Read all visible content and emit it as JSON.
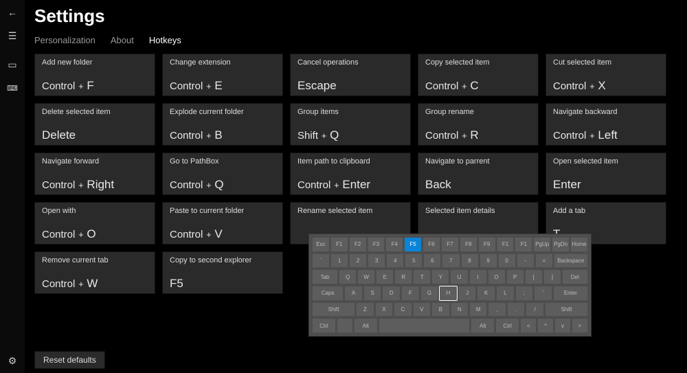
{
  "window": {
    "title": "Settings"
  },
  "tabs": [
    {
      "label": "Personalization",
      "active": false
    },
    {
      "label": "About",
      "active": false
    },
    {
      "label": "Hotkeys",
      "active": true
    }
  ],
  "hotkeys": [
    {
      "label": "Add new folder",
      "combo": "Control + F"
    },
    {
      "label": "Change extension",
      "combo": "Control + E"
    },
    {
      "label": "Cancel operations",
      "combo": "Escape"
    },
    {
      "label": "Copy selected item",
      "combo": "Control + C"
    },
    {
      "label": "Cut selected item",
      "combo": "Control + X"
    },
    {
      "label": "Delete selected item",
      "combo": "Delete"
    },
    {
      "label": "Explode current folder",
      "combo": "Control + B"
    },
    {
      "label": "Group items",
      "combo": "Shift + Q"
    },
    {
      "label": "Group rename",
      "combo": "Control + R"
    },
    {
      "label": "Navigate backward",
      "combo": "Control + Left"
    },
    {
      "label": "Navigate forward",
      "combo": "Control + Right"
    },
    {
      "label": "Go to PathBox",
      "combo": "Control + Q"
    },
    {
      "label": "Item path to clipboard",
      "combo": "Control + Enter"
    },
    {
      "label": "Navigate to parrent",
      "combo": "Back"
    },
    {
      "label": "Open selected item",
      "combo": "Enter"
    },
    {
      "label": "Open with",
      "combo": "Control + O"
    },
    {
      "label": "Paste to current folder",
      "combo": "Control + V"
    },
    {
      "label": "Rename selected item",
      "combo": ""
    },
    {
      "label": "Selected item details",
      "combo": ""
    },
    {
      "label": "Add a tab",
      "combo": "+ T"
    },
    {
      "label": "Remove current tab",
      "combo": "Control + W"
    },
    {
      "label": "Copy to second explorer",
      "combo": "F5"
    }
  ],
  "reset_label": "Reset defaults",
  "keyboard": {
    "highlighted": "F5",
    "selected": "H",
    "rows": [
      [
        "Esc",
        "F1",
        "F2",
        "F3",
        "F4",
        "F5",
        "F6",
        "F7",
        "F8",
        "F9",
        "F1",
        "F1",
        "PgUp",
        "PgDn",
        "Home"
      ],
      [
        "`",
        "1",
        "2",
        "3",
        "4",
        "5",
        "6",
        "7",
        "8",
        "9",
        "0",
        "-",
        "=",
        "Backspace"
      ],
      [
        "Tab",
        "Q",
        "W",
        "E",
        "R",
        "T",
        "Y",
        "U",
        "I",
        "O",
        "P",
        "[",
        "]",
        "Del"
      ],
      [
        "Caps",
        "A",
        "S",
        "D",
        "F",
        "G",
        "H",
        "J",
        "K",
        "L",
        ";",
        "'",
        "Enter"
      ],
      [
        "Shift",
        "Z",
        "X",
        "C",
        "V",
        "B",
        "N",
        "M",
        ",",
        ".",
        "/",
        "Shift"
      ],
      [
        "Ctrl",
        "",
        "Alt",
        "",
        "Alt",
        "Ctrl",
        "<",
        "^",
        "v",
        ">"
      ]
    ]
  }
}
